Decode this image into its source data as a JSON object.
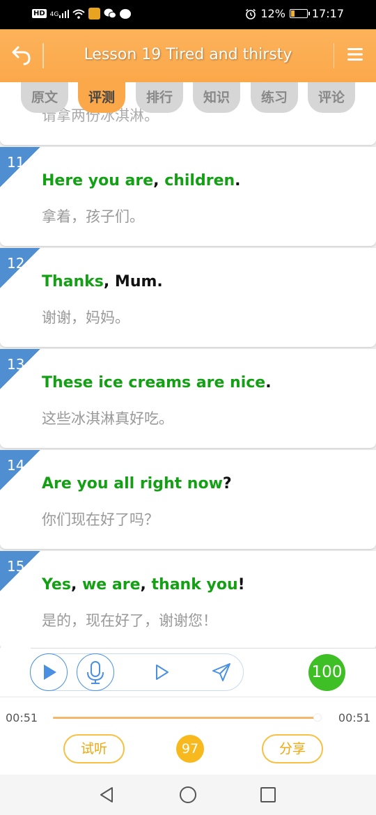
{
  "status_bar": {
    "left_icons": [
      "hd-icon",
      "signal-4g-icon",
      "wifi-icon",
      "app-icon",
      "wechat-icon",
      "chat-icon"
    ],
    "hd_label": "HD",
    "net_label": "4G",
    "battery_text": "12%",
    "time": "17:17"
  },
  "header": {
    "title": "Lesson 19 Tired and thirsty"
  },
  "tabs": [
    {
      "label": "原文",
      "active": false
    },
    {
      "label": "评测",
      "active": true
    },
    {
      "label": "排行",
      "active": false
    },
    {
      "label": "知识",
      "active": false
    },
    {
      "label": "练习",
      "active": false
    },
    {
      "label": "评论",
      "active": false
    }
  ],
  "sentences": [
    {
      "chinese": "请拿两份冰淇淋。",
      "partial": true
    },
    {
      "number": "11",
      "segments": [
        {
          "text": "Here you are",
          "color": "green"
        },
        {
          "text": ", ",
          "color": "black"
        },
        {
          "text": "children",
          "color": "green"
        },
        {
          "text": ".",
          "color": "black"
        }
      ],
      "chinese": "拿着，孩子们。"
    },
    {
      "number": "12",
      "segments": [
        {
          "text": "Thanks",
          "color": "green"
        },
        {
          "text": ", Mum.",
          "color": "black"
        }
      ],
      "chinese": "谢谢，妈妈。"
    },
    {
      "number": "13",
      "segments": [
        {
          "text": "These ice creams are nice",
          "color": "green"
        },
        {
          "text": ".",
          "color": "black"
        }
      ],
      "chinese": "这些冰淇淋真好吃。"
    },
    {
      "number": "14",
      "segments": [
        {
          "text": "Are you all right now",
          "color": "green"
        },
        {
          "text": "?",
          "color": "black"
        }
      ],
      "chinese": "你们现在好了吗？"
    },
    {
      "number": "15",
      "segments": [
        {
          "text": "Yes",
          "color": "green"
        },
        {
          "text": ", ",
          "color": "black"
        },
        {
          "text": "we are",
          "color": "green"
        },
        {
          "text": ", ",
          "color": "black"
        },
        {
          "text": "thank you",
          "color": "green"
        },
        {
          "text": "!",
          "color": "black"
        }
      ],
      "chinese": "是的，现在好了，谢谢您！"
    }
  ],
  "controls": {
    "score": "100"
  },
  "player": {
    "current_time": "00:51",
    "total_time": "00:51",
    "progress_fraction": 0.99,
    "listen_label": "试听",
    "total_score": "97",
    "share_label": "分享"
  },
  "colors": {
    "header_orange": "#fba84a",
    "highlight_green": "#14a014",
    "number_blue": "#4f8fd1",
    "score_green": "#3fbf26",
    "accent_yellow": "#f7b91e"
  }
}
